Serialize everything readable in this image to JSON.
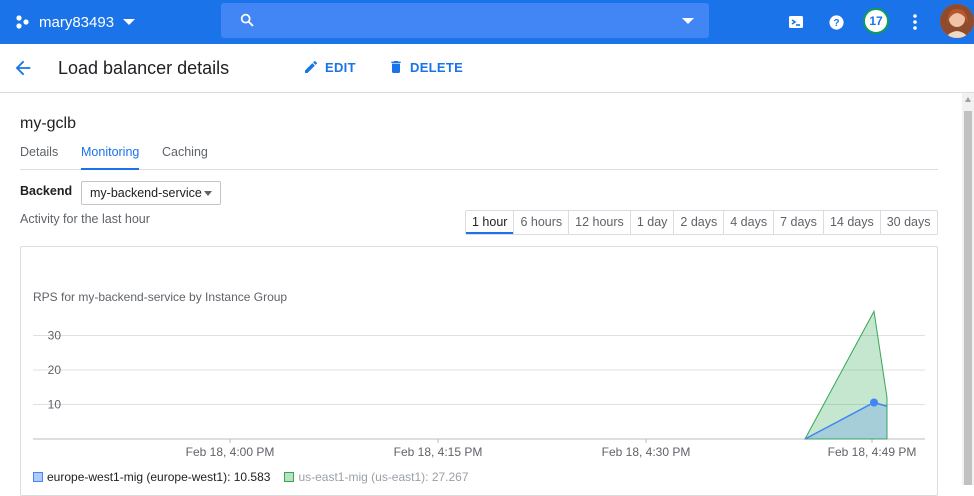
{
  "topbar": {
    "project_name": "mary83493",
    "search_placeholder": "",
    "notifications_count": "17",
    "brand_color": "#1a73e8"
  },
  "header": {
    "title": "Load balancer details",
    "edit_label": "EDIT",
    "delete_label": "DELETE"
  },
  "main": {
    "lb_name": "my-gclb",
    "tabs": [
      {
        "label": "Details"
      },
      {
        "label": "Monitoring"
      },
      {
        "label": "Caching"
      }
    ],
    "active_tab": "Monitoring",
    "backend_label": "Backend",
    "backend_value": "my-backend-service",
    "activity_text": "Activity for the last hour",
    "ranges": [
      {
        "label": "1 hour"
      },
      {
        "label": "6 hours"
      },
      {
        "label": "12 hours"
      },
      {
        "label": "1 day"
      },
      {
        "label": "2 days"
      },
      {
        "label": "4 days"
      },
      {
        "label": "7 days"
      },
      {
        "label": "14 days"
      },
      {
        "label": "30 days"
      }
    ],
    "active_range": "1 hour"
  },
  "chart_data": {
    "type": "area",
    "title": "RPS for my-backend-service by Instance Group",
    "yticks": [
      "30",
      "20",
      "10"
    ],
    "ylim": [
      0,
      37
    ],
    "xticks": [
      "Feb 18, 4:00 PM",
      "Feb 18, 4:15 PM",
      "Feb 18, 4:30 PM",
      "Feb 18, 4:49 PM"
    ],
    "x": [
      "4:45 PM",
      "4:48 PM",
      "4:49 PM"
    ],
    "series": [
      {
        "name": "europe-west1-mig (europe-west1): 10.583",
        "color": "#4285f4",
        "values": [
          0,
          10.583,
          9.5
        ]
      },
      {
        "name": "us-east1-mig (us-east1): 27.267",
        "color": "#34a853",
        "values": [
          0,
          37,
          12
        ]
      }
    ],
    "grid": true,
    "legend": "bottom-left"
  }
}
